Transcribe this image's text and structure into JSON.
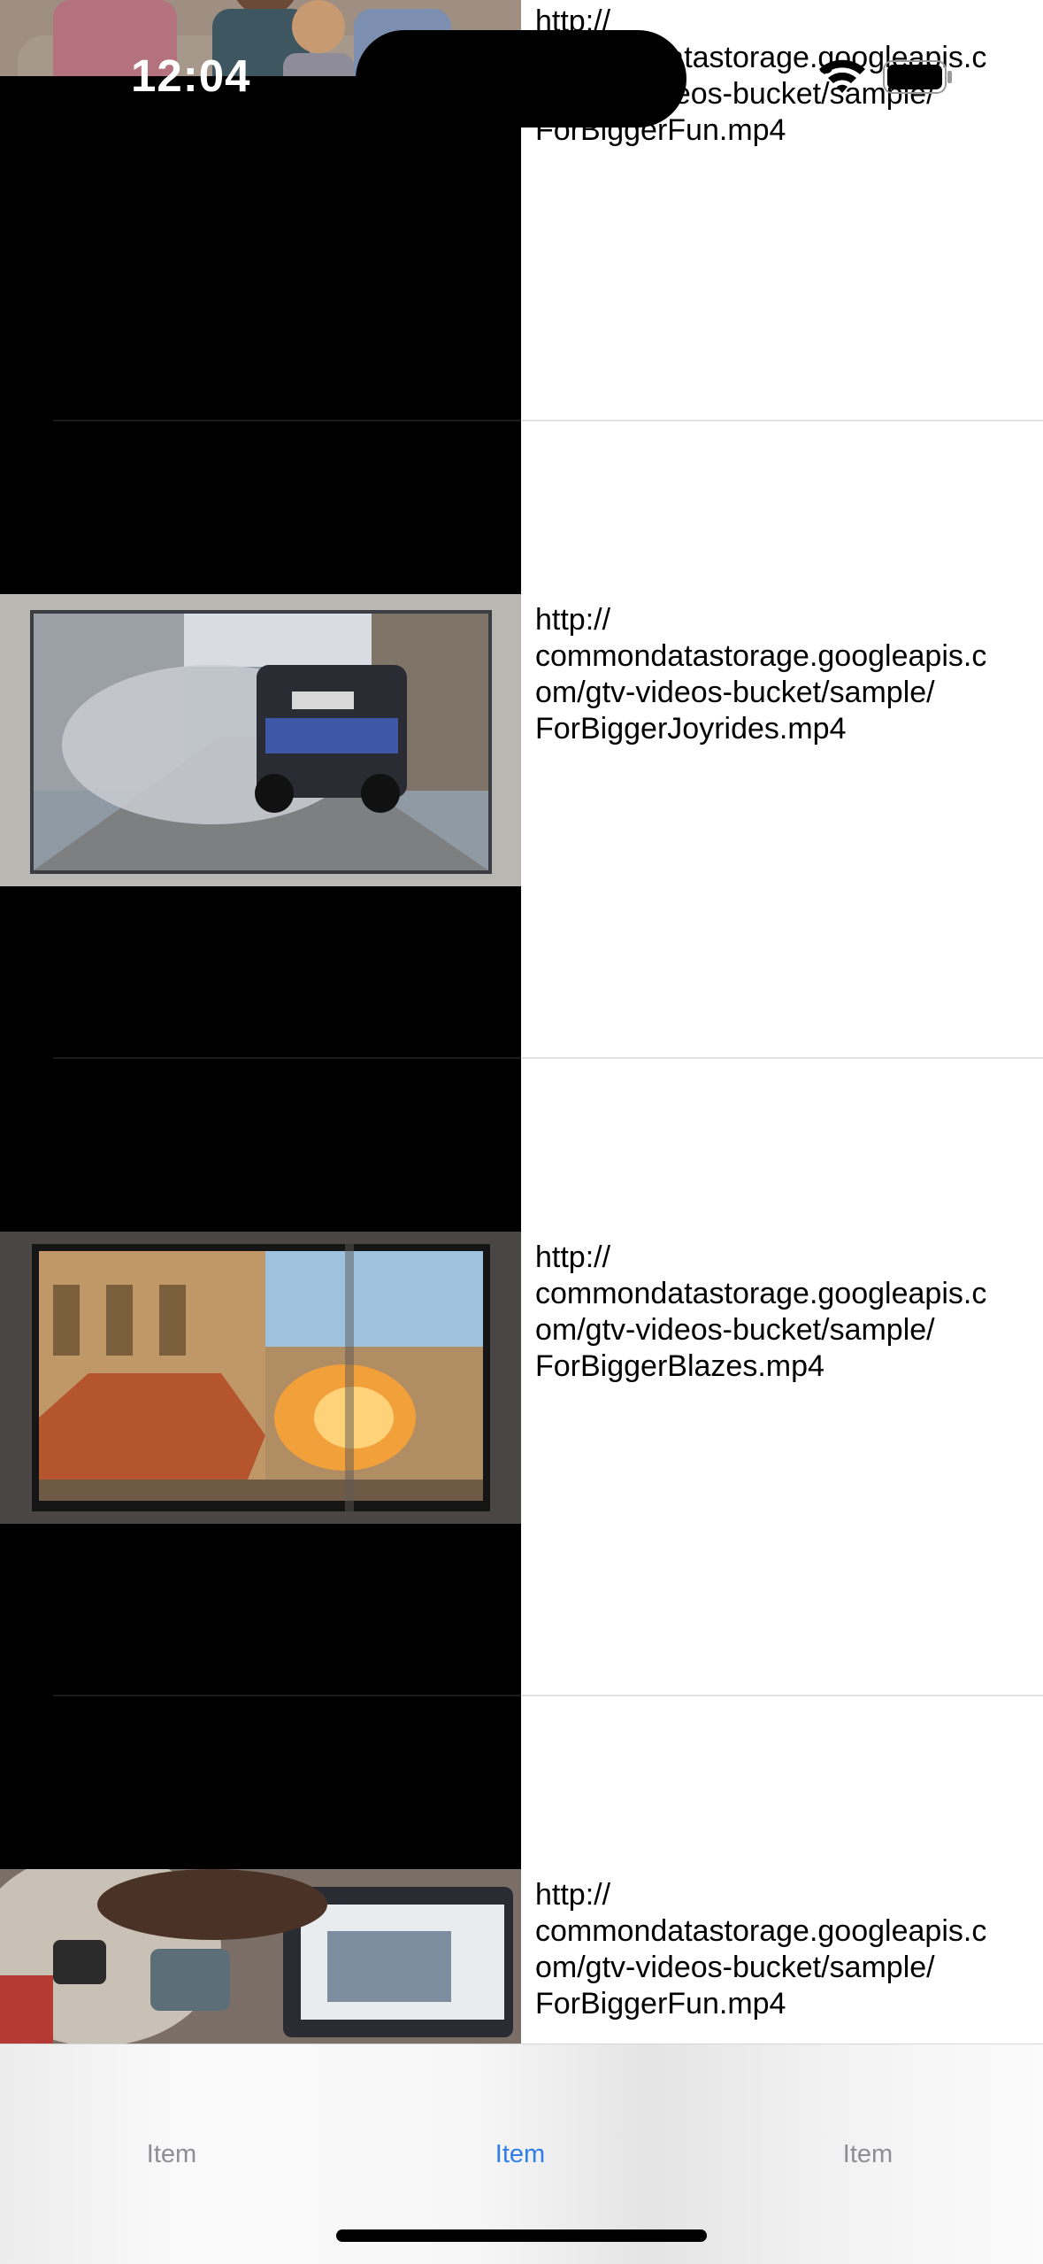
{
  "status_bar": {
    "time": "12:04"
  },
  "videos": [
    {
      "url": "http://\ncommondatastorage.googleapis.c\nom/gtv-videos-bucket/sample/\nForBiggerFun.mp4"
    },
    {
      "url": "http://\ncommondatastorage.googleapis.c\nom/gtv-videos-bucket/sample/\nForBiggerJoyrides.mp4"
    },
    {
      "url": "http://\ncommondatastorage.googleapis.c\nom/gtv-videos-bucket/sample/\nForBiggerBlazes.mp4"
    },
    {
      "url": "http://\ncommondatastorage.googleapis.c\nom/gtv-videos-bucket/sample/\nForBiggerFun.mp4"
    }
  ],
  "tab_bar": {
    "items": [
      {
        "label": "Item",
        "selected": false
      },
      {
        "label": "Item",
        "selected": true
      },
      {
        "label": "Item",
        "selected": false
      }
    ]
  },
  "colors": {
    "accent": "#2f7ee8",
    "inactive_tab": "#8e8e93",
    "thumb_background": "#000000"
  }
}
